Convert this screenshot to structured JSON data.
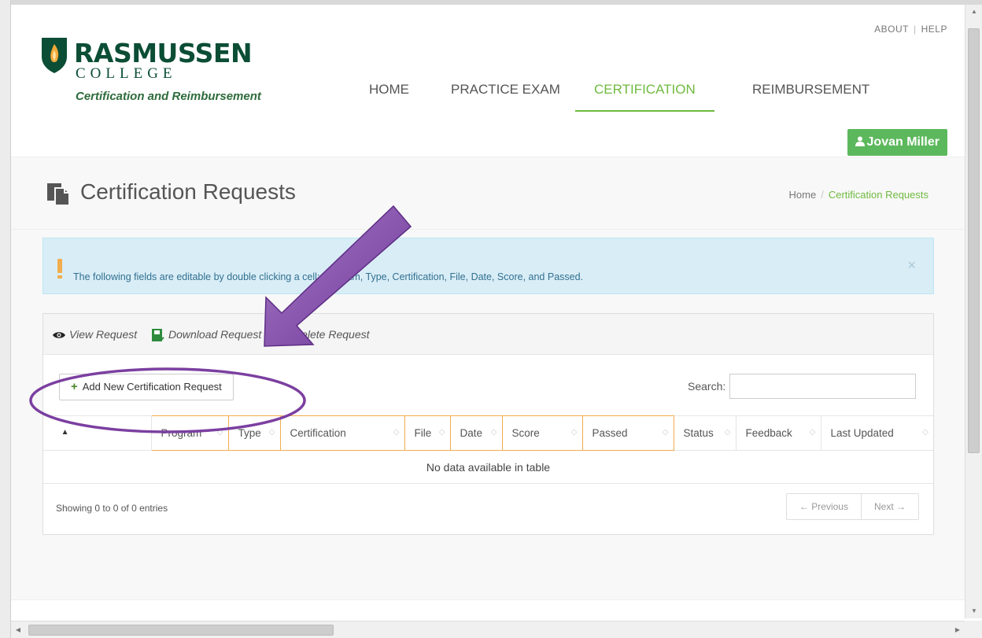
{
  "header": {
    "top_links": [
      "ABOUT",
      "HELP"
    ],
    "brand_name": "RASMUSSEN",
    "brand_sub": "COLLEGE",
    "tagline": "Certification and Reimbursement",
    "nav": [
      "HOME",
      "PRACTICE EXAM",
      "CERTIFICATION",
      "REIMBURSEMENT"
    ],
    "active_nav": "CERTIFICATION",
    "user_name": "Jovan Miller"
  },
  "page": {
    "title": "Certification Requests",
    "breadcrumb": [
      "Home",
      "Certification Requests"
    ]
  },
  "alert": {
    "message": "The following fields are editable by double clicking a cell: Program, Type, Certification, File, Date, Score, and Passed.",
    "close": "×"
  },
  "toolbar": {
    "view": "View Request",
    "download": "Download Request",
    "delete": "Delete Request"
  },
  "actions": {
    "add_new": "Add New Certification Request",
    "search_label": "Search:",
    "search_value": ""
  },
  "table": {
    "columns": [
      "Program",
      "Type",
      "Certification",
      "File",
      "Date",
      "Score",
      "Passed",
      "Status",
      "Feedback",
      "Last Updated"
    ],
    "empty_message": "No data available in table",
    "info": "Showing 0 to 0 of 0 entries",
    "prev": "← Previous",
    "next": "Next →"
  },
  "colors": {
    "brand_green": "#0b4d35",
    "accent_green": "#6fba3f",
    "button_green": "#5cb85c",
    "alert_bg": "#d9edf7",
    "annotation_purple": "#7b3fa0"
  }
}
